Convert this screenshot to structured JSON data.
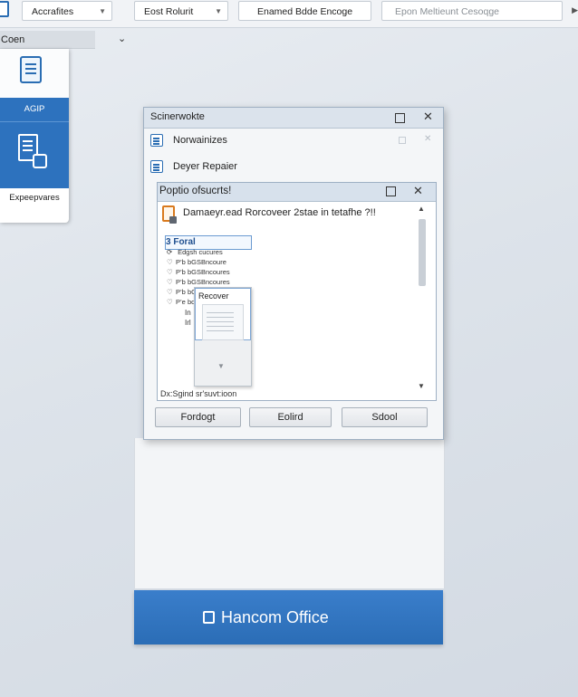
{
  "toolbar": {
    "field1": "Accrafites",
    "field2": "Eost Rolurit",
    "field3": "Enamed Bdde Encoge",
    "field4": "Epon Meltieunt Cesoqge"
  },
  "secondary_bar": {
    "dropdown_label": "Coen"
  },
  "left_panel": {
    "blue_label": "AGIP",
    "bottom_label": "Expeepvares"
  },
  "dialog": {
    "title": "Scinerwokte",
    "items": [
      {
        "label": "Norwainizes"
      },
      {
        "label": "Deyer Repaier"
      }
    ],
    "inner": {
      "title": "Poptio ofsucrts!",
      "message": "Damaeyr.ead Rorcoveer 2stae in tetafhe ?!!",
      "tree_header": "3 Foral",
      "tree_items": [
        {
          "prefix": "",
          "label": "Edgsh cucures"
        },
        {
          "prefix": "P’b",
          "label": "bGSBncoure"
        },
        {
          "prefix": "P’b",
          "label": "bGSBncoures"
        },
        {
          "prefix": "P’b",
          "label": "bGSBncoures"
        },
        {
          "prefix": "P’b",
          "label": "bG"
        },
        {
          "prefix": "P’e",
          "label": "bd"
        }
      ],
      "tree_extra": [
        "In",
        "Irl"
      ],
      "popup_label": "Recover",
      "status": "Dx:Sgind sr'suvt:ioon"
    },
    "buttons": {
      "b1": "Fordogt",
      "b2": "Eolird",
      "b3": "Sdool"
    }
  },
  "banner": {
    "text": "Hancom Office"
  }
}
